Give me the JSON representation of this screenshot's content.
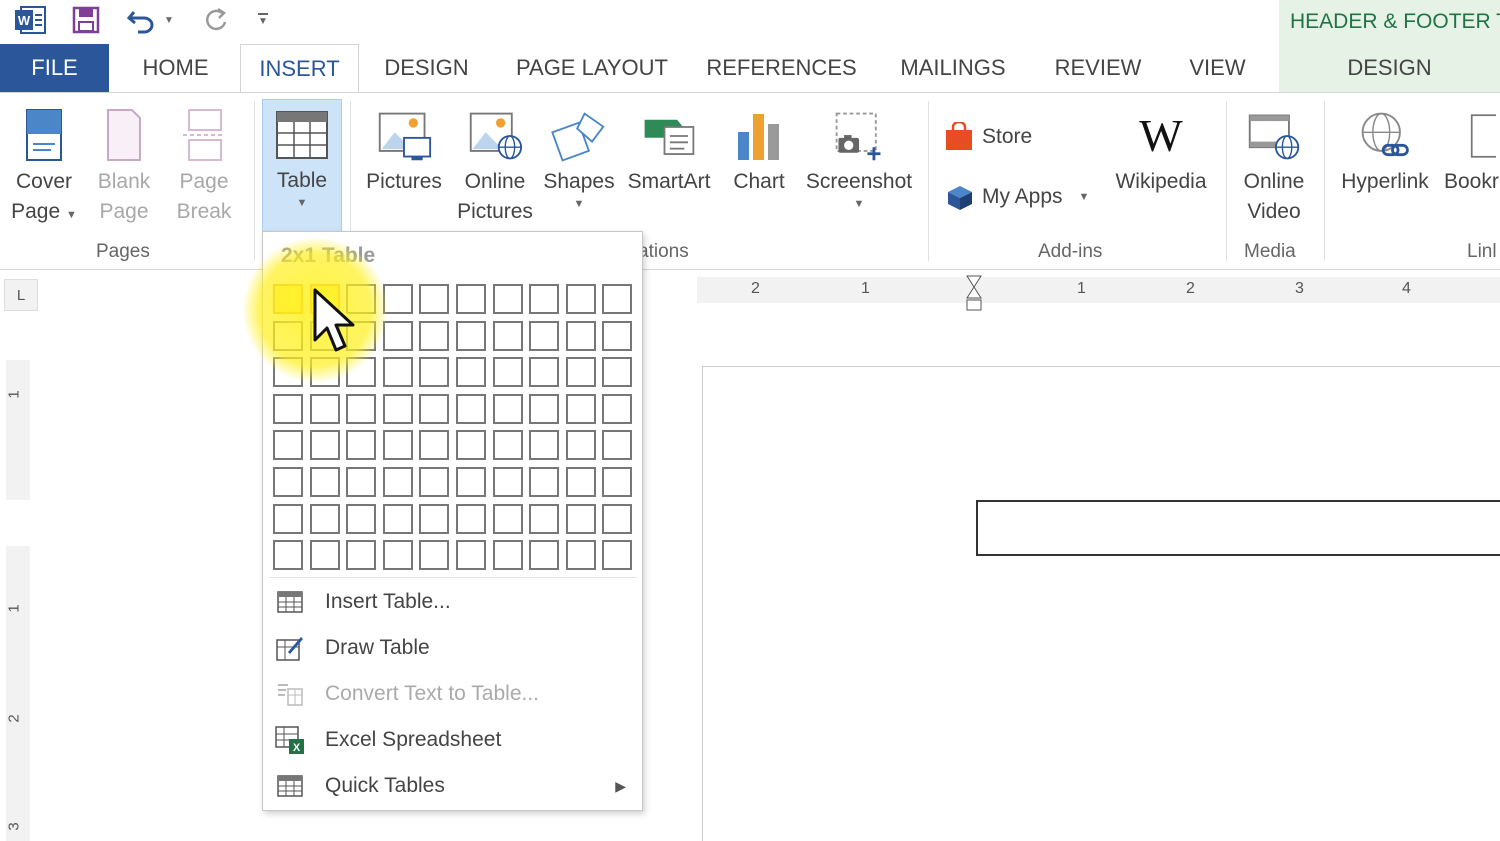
{
  "quick_access": {
    "app_icon": "word-icon",
    "save_icon": "save-icon",
    "undo_icon": "undo-icon",
    "redo_icon": "redo-icon",
    "customize_icon": "customize-qat-icon"
  },
  "contextual_tab": {
    "label": "HEADER & FOOTER TOOLS",
    "color": "#217346"
  },
  "tabs": [
    "FILE",
    "HOME",
    "INSERT",
    "DESIGN",
    "PAGE LAYOUT",
    "REFERENCES",
    "MAILINGS",
    "REVIEW",
    "VIEW",
    "DESIGN"
  ],
  "active_tab": "INSERT",
  "ribbon": {
    "pages_group": {
      "label": "Pages",
      "cover_line1": "Cover",
      "cover_line2": "Page",
      "blank_line1": "Blank",
      "blank_line2": "Page",
      "break_line1": "Page",
      "break_line2": "Break"
    },
    "tables_group": {
      "table_label": "Table"
    },
    "illustrations_group": {
      "label_visible": "ations",
      "pictures": "Pictures",
      "online_pictures_1": "Online",
      "online_pictures_2": "Pictures",
      "shapes": "Shapes",
      "smartart": "SmartArt",
      "chart": "Chart",
      "screenshot": "Screenshot"
    },
    "addins_group": {
      "label": "Add-ins",
      "store": "Store",
      "my_apps": "My Apps",
      "wikipedia": "Wikipedia"
    },
    "media_group": {
      "label": "Media",
      "video_1": "Online",
      "video_2": "Video"
    },
    "links_group": {
      "label": "Linl",
      "hyperlink": "Hyperlink",
      "bookmark": "Bookr"
    }
  },
  "table_menu": {
    "title": "2x1 Table",
    "grid_cols": 10,
    "grid_rows": 8,
    "selected_cols": 2,
    "selected_rows": 1,
    "items": [
      {
        "label": "Insert Table...",
        "icon": "insert-table-icon",
        "enabled": true
      },
      {
        "label": "Draw Table",
        "icon": "draw-table-icon",
        "enabled": true
      },
      {
        "label": "Convert Text to Table...",
        "icon": "convert-text-icon",
        "enabled": false
      },
      {
        "label": "Excel Spreadsheet",
        "icon": "excel-spreadsheet-icon",
        "enabled": true
      },
      {
        "label": "Quick Tables",
        "icon": "quick-tables-icon",
        "enabled": true,
        "submenu": true
      }
    ]
  },
  "rulers": {
    "horizontal": [
      "2",
      "1",
      "1",
      "2",
      "3",
      "4"
    ],
    "vertical": [
      "1",
      "1",
      "2",
      "3"
    ],
    "tab_selector": "L"
  },
  "colors": {
    "file_tab": "#2b579a",
    "accent": "#2b579a",
    "highlight": "#fff36a"
  }
}
